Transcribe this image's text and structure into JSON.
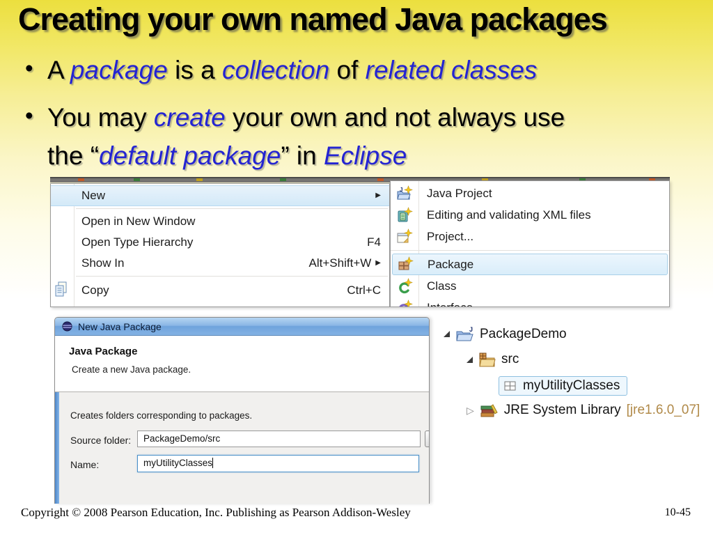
{
  "slide": {
    "title": "Creating your own named Java packages",
    "bullets": [
      {
        "segments": [
          {
            "text": "A ",
            "style": "plain"
          },
          {
            "text": "package",
            "style": "em"
          },
          {
            "text": " is a ",
            "style": "plain"
          },
          {
            "text": "collection",
            "style": "em"
          },
          {
            "text": " of ",
            "style": "plain"
          },
          {
            "text": "related classes",
            "style": "em"
          }
        ]
      },
      {
        "segments": [
          {
            "text": "You may ",
            "style": "plain"
          },
          {
            "text": "create",
            "style": "em"
          },
          {
            "text": " your own and not always use",
            "style": "plain"
          },
          {
            "text": "the “",
            "style": "plain"
          },
          {
            "text": "default package",
            "style": "em"
          },
          {
            "text": "” in ",
            "style": "plain"
          },
          {
            "text": "Eclipse",
            "style": "em"
          }
        ]
      }
    ],
    "footer": {
      "copyright": "Copyright © 2008 Pearson Education, Inc. Publishing as Pearson Addison-Wesley",
      "page_number": "10-45"
    }
  },
  "context_menu": {
    "items": [
      {
        "label": "New",
        "shortcut": "",
        "highlighted": true,
        "has_submenu": true
      },
      {
        "label": "Open in New Window",
        "shortcut": ""
      },
      {
        "label": "Open Type Hierarchy",
        "shortcut": "F4"
      },
      {
        "label": "Show In",
        "shortcut": "Alt+Shift+W",
        "has_submenu": true
      },
      {
        "label": "Copy",
        "shortcut": "Ctrl+C",
        "icon": "copy-icon"
      }
    ]
  },
  "new_submenu": {
    "items": [
      {
        "label": "Java Project",
        "icon": "java-project-icon"
      },
      {
        "label": "Editing and validating XML files",
        "icon": "xml-file-icon"
      },
      {
        "label": "Project...",
        "icon": "project-icon"
      },
      {
        "label": "Package",
        "icon": "package-icon",
        "highlighted": true
      },
      {
        "label": "Class",
        "icon": "class-icon"
      },
      {
        "label": "Interface",
        "icon": "interface-icon",
        "clipped": true
      }
    ]
  },
  "dialog": {
    "title": "New Java Package",
    "icon": "eclipse-logo-icon",
    "heading": "Java Package",
    "subtitle": "Create a new Java package.",
    "description": "Creates folders corresponding to packages.",
    "fields": [
      {
        "label": "Source folder:",
        "value": "PackageDemo/src",
        "focused": false
      },
      {
        "label": "Name:",
        "value": "myUtilityClasses",
        "focused": true
      }
    ]
  },
  "package_explorer": {
    "items": [
      {
        "label": "PackageDemo",
        "icon": "java-project-folder-icon",
        "state": "expanded",
        "indent": 0,
        "selected": false
      },
      {
        "label": "src",
        "icon": "source-folder-icon",
        "state": "expanded",
        "indent": 1,
        "selected": false
      },
      {
        "label": "myUtilityClasses",
        "icon": "empty-package-icon",
        "state": "leaf",
        "indent": 2,
        "selected": true
      },
      {
        "label": "JRE System Library",
        "suffix": "[jre1.6.0_07]",
        "icon": "library-icon",
        "state": "collapsed",
        "indent": 1,
        "selected": false
      }
    ]
  },
  "colors": {
    "accent_text_blue": "#2424d2",
    "slide_top_yellow": "#ecdf3e",
    "menu_highlight_blue": "#d9edfa",
    "dialog_titlebar_blue": "#7fadde",
    "tree_selection_border": "#8ec0e0",
    "jre_version_text": "#b08948"
  }
}
